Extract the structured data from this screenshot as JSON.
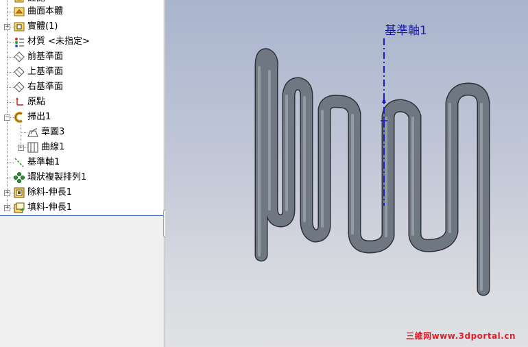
{
  "tree": {
    "items": [
      {
        "label": "註記",
        "icon": "annotation-icon"
      },
      {
        "label": "曲面本體",
        "icon": "surface-bodies-icon"
      },
      {
        "label": "實體(1)",
        "icon": "solid-bodies-icon"
      },
      {
        "label": "材質 <未指定>",
        "icon": "material-icon"
      },
      {
        "label": "前基準面",
        "icon": "plane-icon"
      },
      {
        "label": "上基準面",
        "icon": "plane-icon"
      },
      {
        "label": "右基準面",
        "icon": "plane-icon"
      },
      {
        "label": "原點",
        "icon": "origin-icon"
      },
      {
        "label": "掃出1",
        "icon": "sweep-icon"
      },
      {
        "label": "草圖3",
        "icon": "sketch-icon"
      },
      {
        "label": "曲線1",
        "icon": "curve-icon"
      },
      {
        "label": "基準軸1",
        "icon": "axis-icon"
      },
      {
        "label": "環狀複製排列1",
        "icon": "circular-pattern-icon"
      },
      {
        "label": "除料-伸長1",
        "icon": "cut-extrude-icon"
      },
      {
        "label": "填料-伸長1",
        "icon": "boss-extrude-icon"
      }
    ]
  },
  "viewport": {
    "axis_label": "基準軸1",
    "watermark": "三維网www.3dportal.cn"
  },
  "colors": {
    "axis": "#1a1ad0",
    "tube": "#6b7480",
    "viewport_top": "#a9b4cd",
    "viewport_bottom": "#e0e1e4",
    "watermark": "#e0202a"
  }
}
